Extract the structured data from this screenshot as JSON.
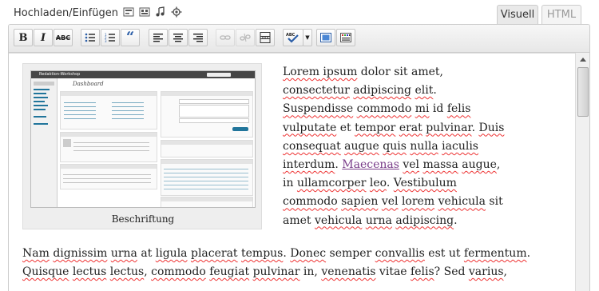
{
  "header": {
    "upload_label": "Hochladen/Einfügen",
    "media_buttons": [
      {
        "name": "add-image-icon"
      },
      {
        "name": "add-gallery-icon"
      },
      {
        "name": "add-audio-icon"
      },
      {
        "name": "add-media-icon"
      }
    ],
    "tabs": {
      "visual": "Visuell",
      "html": "HTML",
      "active": "Visuell"
    }
  },
  "toolbar": {
    "buttons": [
      {
        "name": "bold-button",
        "glyph": "B",
        "enabled": true
      },
      {
        "name": "italic-button",
        "glyph": "I",
        "enabled": true
      },
      {
        "name": "strikethrough-button",
        "glyph": "ABC",
        "enabled": true
      },
      {
        "name": "bullet-list-button",
        "glyph": "",
        "enabled": true
      },
      {
        "name": "numbered-list-button",
        "glyph": "",
        "enabled": true
      },
      {
        "name": "blockquote-button",
        "glyph": "“",
        "enabled": true
      },
      {
        "name": "align-left-button",
        "glyph": "",
        "enabled": true
      },
      {
        "name": "align-center-button",
        "glyph": "",
        "enabled": true
      },
      {
        "name": "align-right-button",
        "glyph": "",
        "enabled": true
      },
      {
        "name": "insert-link-button",
        "glyph": "",
        "enabled": false
      },
      {
        "name": "remove-link-button",
        "glyph": "",
        "enabled": false
      },
      {
        "name": "insert-more-tag-button",
        "glyph": "",
        "enabled": true
      },
      {
        "name": "spellcheck-button",
        "glyph": "ABC",
        "enabled": true
      },
      {
        "name": "fullscreen-button",
        "glyph": "",
        "enabled": true
      },
      {
        "name": "kitchen-sink-button",
        "glyph": "",
        "enabled": true
      }
    ]
  },
  "content": {
    "figure": {
      "caption": "Beschriftung",
      "embedded_screenshot": {
        "site_title": "Redaktion-Workshop",
        "page_title": "Dashboard"
      }
    },
    "paragraph1": {
      "parts": [
        {
          "t": "Lorem",
          "sq": true
        },
        {
          "t": " ipsum",
          "sq": true
        },
        {
          "t": " dolor sit amet, "
        },
        {
          "t": "consectetur",
          "sq": true
        },
        {
          "t": " "
        },
        {
          "t": "adipiscing",
          "sq": true
        },
        {
          "t": " "
        },
        {
          "t": "elit",
          "sq": true
        },
        {
          "t": ". "
        },
        {
          "t": "Suspendisse",
          "sq": true
        },
        {
          "t": " "
        },
        {
          "t": "commodo",
          "sq": true
        },
        {
          "t": " "
        },
        {
          "t": "mi",
          "sq": true
        },
        {
          "t": " id "
        },
        {
          "t": "felis",
          "sq": true
        },
        {
          "t": " "
        },
        {
          "t": "vulputate",
          "sq": true
        },
        {
          "t": " et "
        },
        {
          "t": "tempor",
          "sq": true
        },
        {
          "t": " "
        },
        {
          "t": "erat",
          "sq": true
        },
        {
          "t": " "
        },
        {
          "t": "pulvinar",
          "sq": true
        },
        {
          "t": ". "
        },
        {
          "t": "Duis",
          "sq": true
        },
        {
          "t": " "
        },
        {
          "t": "consequat",
          "sq": true
        },
        {
          "t": " "
        },
        {
          "t": "augue",
          "sq": true
        },
        {
          "t": " "
        },
        {
          "t": "quis",
          "sq": true
        },
        {
          "t": " "
        },
        {
          "t": "nulla",
          "sq": true
        },
        {
          "t": " "
        },
        {
          "t": "iaculis",
          "sq": true
        },
        {
          "t": " "
        },
        {
          "t": "interdum",
          "sq": true
        },
        {
          "t": ". "
        },
        {
          "t": "Maecenas",
          "link": true
        },
        {
          "t": " "
        },
        {
          "t": "vel",
          "sq": true
        },
        {
          "t": " "
        },
        {
          "t": "massa",
          "sq": true
        },
        {
          "t": " "
        },
        {
          "t": "augue",
          "sq": true
        },
        {
          "t": ", in "
        },
        {
          "t": "ullamcorper",
          "sq": true
        },
        {
          "t": " "
        },
        {
          "t": "leo",
          "sq": true
        },
        {
          "t": ". "
        },
        {
          "t": "Vestibulum",
          "sq": true
        },
        {
          "t": " "
        },
        {
          "t": "commodo",
          "sq": true
        },
        {
          "t": " "
        },
        {
          "t": "sapien",
          "sq": true
        },
        {
          "t": " "
        },
        {
          "t": "vel",
          "sq": true
        },
        {
          "t": " "
        },
        {
          "t": "lorem",
          "sq": true
        },
        {
          "t": " "
        },
        {
          "t": "vehicula",
          "sq": true
        },
        {
          "t": " sit amet "
        },
        {
          "t": "vehicula",
          "sq": true
        },
        {
          "t": " "
        },
        {
          "t": "urna",
          "sq": true
        },
        {
          "t": " "
        },
        {
          "t": "adipiscing",
          "sq": true
        },
        {
          "t": "."
        }
      ]
    },
    "paragraph2": {
      "parts": [
        {
          "t": "Nam",
          "sq": true
        },
        {
          "t": " "
        },
        {
          "t": "dignissim",
          "sq": true
        },
        {
          "t": " "
        },
        {
          "t": "urna",
          "sq": true
        },
        {
          "t": " at "
        },
        {
          "t": "ligula",
          "sq": true
        },
        {
          "t": " "
        },
        {
          "t": "placerat",
          "sq": true
        },
        {
          "t": " "
        },
        {
          "t": "tempus",
          "sq": true
        },
        {
          "t": ". "
        },
        {
          "t": "Donec",
          "sq": true
        },
        {
          "t": " semper "
        },
        {
          "t": "convallis",
          "sq": true
        },
        {
          "t": " est ut "
        },
        {
          "t": "fermentum",
          "sq": true
        },
        {
          "t": ". "
        },
        {
          "t": "Quisque",
          "sq": true
        },
        {
          "t": " "
        },
        {
          "t": "lectus",
          "sq": true
        },
        {
          "t": " "
        },
        {
          "t": "lectus",
          "sq": true
        },
        {
          "t": ", "
        },
        {
          "t": "commodo",
          "sq": true
        },
        {
          "t": " "
        },
        {
          "t": "feugiat",
          "sq": true
        },
        {
          "t": " "
        },
        {
          "t": "pulvinar",
          "sq": true
        },
        {
          "t": " in, "
        },
        {
          "t": "venenatis",
          "sq": true
        },
        {
          "t": " vitae "
        },
        {
          "t": "felis",
          "sq": true
        },
        {
          "t": "? Sed "
        },
        {
          "t": "varius",
          "sq": true
        },
        {
          "t": ","
        }
      ]
    }
  },
  "colors": {
    "link": "#7a3d8a",
    "spellcheck_underline": "#e33333",
    "toolbar_bg": "#eeeeee"
  }
}
